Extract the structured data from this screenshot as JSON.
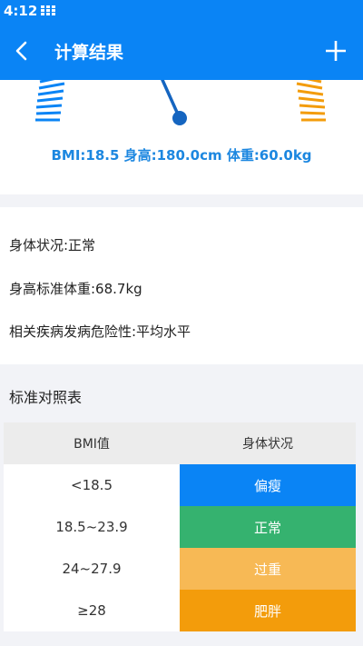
{
  "status_bar": {
    "time": "4:12"
  },
  "app_bar": {
    "title": "计算结果"
  },
  "result": {
    "summary": "BMI:18.5  身高:180.0cm  体重:60.0kg"
  },
  "info": {
    "body_state": "身体状况:正常",
    "standard_weight": "身高标准体重:68.7kg",
    "risk": "相关疾病发病危险性:平均水平"
  },
  "table": {
    "title": "标准对照表",
    "headers": [
      "BMI值",
      "身体状况"
    ],
    "rows": [
      {
        "range": "<18.5",
        "state": "偏瘦",
        "color": "#0a84f5"
      },
      {
        "range": "18.5~23.9",
        "state": "正常",
        "color": "#35b26f"
      },
      {
        "range": "24~27.9",
        "state": "过重",
        "color": "#f7b955"
      },
      {
        "range": "≥28",
        "state": "肥胖",
        "color": "#f39c0b"
      }
    ]
  },
  "colors": {
    "primary": "#0a84f5",
    "accent_text": "#1c87e0",
    "warning": "#f39c0b"
  },
  "icons": [
    "back-arrow-icon",
    "plus-icon",
    "grid-icon"
  ]
}
